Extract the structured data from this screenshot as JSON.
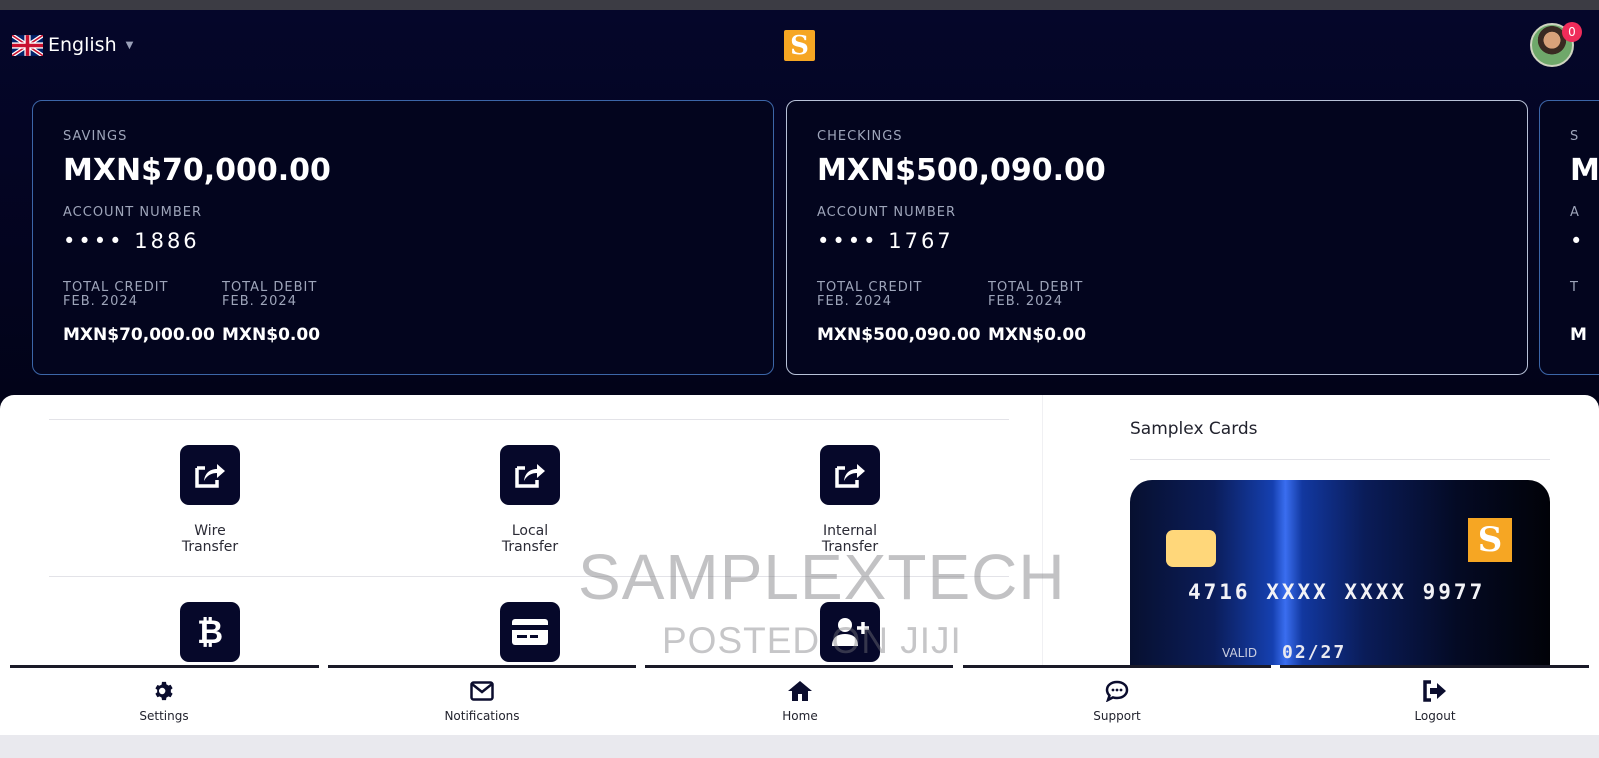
{
  "header": {
    "language_label": "English",
    "notification_count": "0"
  },
  "logo": {
    "glyph": "S"
  },
  "accounts": [
    {
      "type": "SAVINGS",
      "balance": "MXN$70,000.00",
      "account_number_label": "ACCOUNT NUMBER",
      "account_number": "•••• 1886",
      "credit_label": "TOTAL CREDIT",
      "credit_period": "FEB. 2024",
      "credit_value": "MXN$70,000.00",
      "debit_label": "TOTAL DEBIT",
      "debit_period": "FEB. 2024",
      "debit_value": "MXN$0.00"
    },
    {
      "type": "CHECKINGS",
      "balance": "MXN$500,090.00",
      "account_number_label": "ACCOUNT NUMBER",
      "account_number": "•••• 1767",
      "credit_label": "TOTAL CREDIT",
      "credit_period": "FEB. 2024",
      "credit_value": "MXN$500,090.00",
      "debit_label": "TOTAL DEBIT",
      "debit_period": "FEB. 2024",
      "debit_value": "MXN$0.00"
    },
    {
      "type": "S",
      "balance": "M",
      "account_number_label": "A",
      "account_number": "•",
      "credit_label": "T",
      "credit_value": "M"
    }
  ],
  "actions": [
    {
      "label": "Wire\nTransfer",
      "icon": "share-icon"
    },
    {
      "label": "Local\nTransfer",
      "icon": "share-icon"
    },
    {
      "label": "Internal\nTransfer",
      "icon": "share-icon"
    },
    {
      "label": "",
      "icon": "bitcoin-icon"
    },
    {
      "label": "",
      "icon": "credit-card-icon"
    },
    {
      "label": "",
      "icon": "add-user-icon"
    }
  ],
  "cards_panel": {
    "title": "Samplex Cards",
    "card_number": "4716 XXXX XXXX 9977",
    "valid_label": "VALID",
    "expiry": "02/27"
  },
  "watermark": {
    "line1": "SAMPLEXTECH",
    "line2": "POSTED ON JIJI"
  },
  "bottom_nav": [
    {
      "label": "Settings",
      "icon": "gear-icon"
    },
    {
      "label": "Notifications",
      "icon": "envelope-icon"
    },
    {
      "label": "Home",
      "icon": "home-icon"
    },
    {
      "label": "Support",
      "icon": "chat-icon"
    },
    {
      "label": "Logout",
      "icon": "logout-icon"
    }
  ],
  "colors": {
    "navy": "#05062a",
    "accent_gold": "#f6a623",
    "badge": "#ef2c5a",
    "card_border": "#3c66a8"
  }
}
